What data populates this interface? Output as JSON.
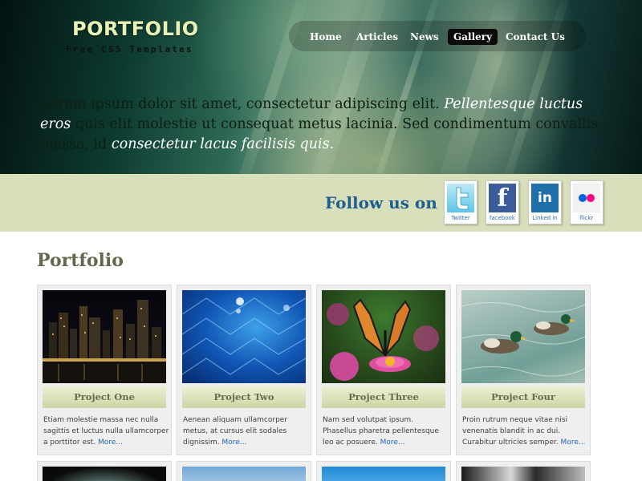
{
  "header": {
    "logo": "PORTFOLIO",
    "tagline": "Free CSS Templates",
    "nav": [
      "Home",
      "Articles",
      "News",
      "Gallery",
      "Contact Us"
    ],
    "active_nav": "Gallery",
    "hero": [
      {
        "text": "Lorem ipsum dolor sit amet, consectetur adipiscing elit. ",
        "italic": false
      },
      {
        "text": "Pellentesque luctus eros",
        "italic": true
      },
      {
        "text": " quis elit molestie ut consequat metus lacinia. Sed condimentum convallis massa, id ",
        "italic": false
      },
      {
        "text": "consectetur lacus facilisis quis.",
        "italic": true
      }
    ]
  },
  "follow": {
    "label": "Follow us on",
    "networks": [
      {
        "name": "Twitter",
        "icon": "twitter-icon",
        "caption": "Twitter"
      },
      {
        "name": "Facebook",
        "icon": "facebook-icon",
        "caption": "facebook"
      },
      {
        "name": "LinkedIn",
        "icon": "linkedin-icon",
        "caption": "Linked in"
      },
      {
        "name": "Flickr",
        "icon": "flickr-icon",
        "caption": "flickr"
      }
    ]
  },
  "portfolio": {
    "title": "Portfolio",
    "more_label": "More...",
    "projects": [
      {
        "name": "Project One",
        "image": "city-night-skyline",
        "text": "Etiam molestie massa nec nulla sagittis et luctus nulla ullamcorper a porttitor est."
      },
      {
        "name": "Project Two",
        "image": "blue-net-water-drops",
        "text": "Aenean aliquam ullamcorper metus, at cursus elit sodales dignissim."
      },
      {
        "name": "Project Three",
        "image": "butterfly-on-pink-flower",
        "text": "Nam sed volutpat ipsum. Phasellus pharetra pellentesque leo ac posuere."
      },
      {
        "name": "Project Four",
        "image": "ducks-on-water",
        "text": "Proin rutrum neque vitae nisi venenatis blandit in ac dui. Curabitur ultricies semper."
      }
    ]
  },
  "colors": {
    "follow_bar": "#d8dfba",
    "accent_blue": "#1c5e8e",
    "heading": "#65664e",
    "link": "#1d66b8"
  }
}
